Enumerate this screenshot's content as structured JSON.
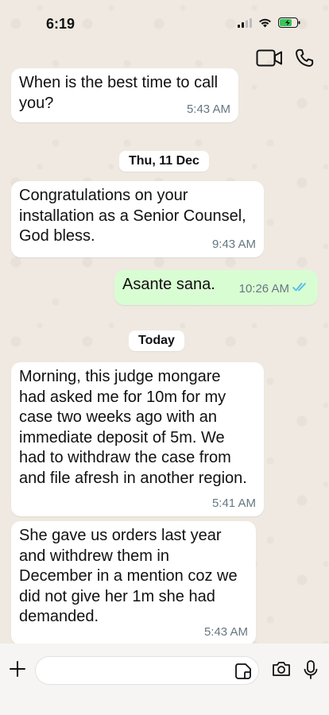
{
  "status_bar": {
    "time": "6:19"
  },
  "header": {
    "video_icon": "video-call-icon",
    "call_icon": "phone-call-icon"
  },
  "messages": [
    {
      "direction": "in",
      "text": "When is the best time to call\nyou?",
      "time": "5:43 AM"
    },
    {
      "direction": "in",
      "text": "Congratulations on your\ninstallation as a Senior Counsel,\nGod bless.",
      "time": "9:43 AM"
    },
    {
      "direction": "out",
      "text": "Asante sana.",
      "time": "10:26 AM",
      "status_icon": "double-check-read-icon"
    },
    {
      "direction": "in",
      "text": "Morning, this judge mongare\nhad asked me for 10m for my\ncase two weeks ago with an\nimmediate deposit of 5m. We\nhad to withdraw the case from\nand file afresh in another region.",
      "time": "5:41 AM"
    },
    {
      "direction": "in",
      "text": "She gave us orders last year\nand withdrew them in\nDecember in a mention coz we\ndid not give her 1m she had\ndemanded.",
      "time": "5:43 AM"
    }
  ],
  "date_separators": [
    "Thu, 11 Dec",
    "Today"
  ],
  "composer": {
    "plus_icon": "plus-icon",
    "sticker_icon": "sticker-icon",
    "camera_icon": "camera-icon",
    "mic_icon": "microphone-icon"
  },
  "colors": {
    "incoming_bubble": "#ffffff",
    "outgoing_bubble": "#d9fdd3",
    "read_tick": "#53bdeb",
    "timestamp": "#667781"
  }
}
